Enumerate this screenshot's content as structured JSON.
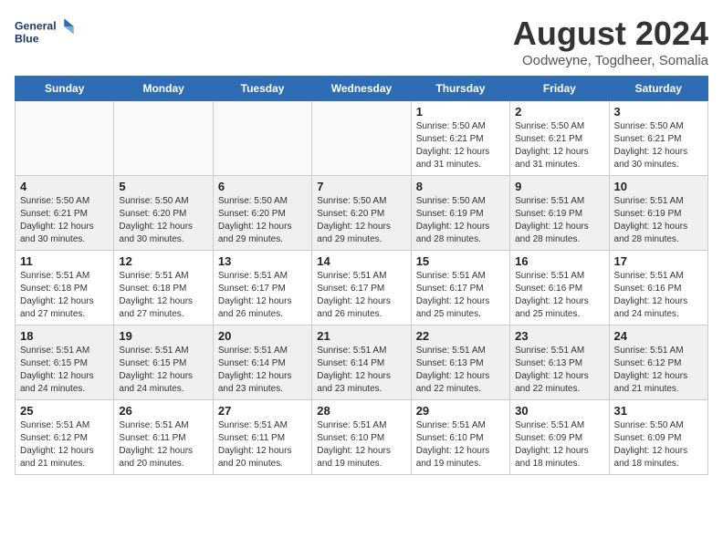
{
  "logo": {
    "line1": "General",
    "line2": "Blue"
  },
  "title": "August 2024",
  "location": "Oodweyne, Togdheer, Somalia",
  "days_of_week": [
    "Sunday",
    "Monday",
    "Tuesday",
    "Wednesday",
    "Thursday",
    "Friday",
    "Saturday"
  ],
  "weeks": [
    [
      {
        "day": "",
        "info": ""
      },
      {
        "day": "",
        "info": ""
      },
      {
        "day": "",
        "info": ""
      },
      {
        "day": "",
        "info": ""
      },
      {
        "day": "1",
        "info": "Sunrise: 5:50 AM\nSunset: 6:21 PM\nDaylight: 12 hours\nand 31 minutes."
      },
      {
        "day": "2",
        "info": "Sunrise: 5:50 AM\nSunset: 6:21 PM\nDaylight: 12 hours\nand 31 minutes."
      },
      {
        "day": "3",
        "info": "Sunrise: 5:50 AM\nSunset: 6:21 PM\nDaylight: 12 hours\nand 30 minutes."
      }
    ],
    [
      {
        "day": "4",
        "info": "Sunrise: 5:50 AM\nSunset: 6:21 PM\nDaylight: 12 hours\nand 30 minutes."
      },
      {
        "day": "5",
        "info": "Sunrise: 5:50 AM\nSunset: 6:20 PM\nDaylight: 12 hours\nand 30 minutes."
      },
      {
        "day": "6",
        "info": "Sunrise: 5:50 AM\nSunset: 6:20 PM\nDaylight: 12 hours\nand 29 minutes."
      },
      {
        "day": "7",
        "info": "Sunrise: 5:50 AM\nSunset: 6:20 PM\nDaylight: 12 hours\nand 29 minutes."
      },
      {
        "day": "8",
        "info": "Sunrise: 5:50 AM\nSunset: 6:19 PM\nDaylight: 12 hours\nand 28 minutes."
      },
      {
        "day": "9",
        "info": "Sunrise: 5:51 AM\nSunset: 6:19 PM\nDaylight: 12 hours\nand 28 minutes."
      },
      {
        "day": "10",
        "info": "Sunrise: 5:51 AM\nSunset: 6:19 PM\nDaylight: 12 hours\nand 28 minutes."
      }
    ],
    [
      {
        "day": "11",
        "info": "Sunrise: 5:51 AM\nSunset: 6:18 PM\nDaylight: 12 hours\nand 27 minutes."
      },
      {
        "day": "12",
        "info": "Sunrise: 5:51 AM\nSunset: 6:18 PM\nDaylight: 12 hours\nand 27 minutes."
      },
      {
        "day": "13",
        "info": "Sunrise: 5:51 AM\nSunset: 6:17 PM\nDaylight: 12 hours\nand 26 minutes."
      },
      {
        "day": "14",
        "info": "Sunrise: 5:51 AM\nSunset: 6:17 PM\nDaylight: 12 hours\nand 26 minutes."
      },
      {
        "day": "15",
        "info": "Sunrise: 5:51 AM\nSunset: 6:17 PM\nDaylight: 12 hours\nand 25 minutes."
      },
      {
        "day": "16",
        "info": "Sunrise: 5:51 AM\nSunset: 6:16 PM\nDaylight: 12 hours\nand 25 minutes."
      },
      {
        "day": "17",
        "info": "Sunrise: 5:51 AM\nSunset: 6:16 PM\nDaylight: 12 hours\nand 24 minutes."
      }
    ],
    [
      {
        "day": "18",
        "info": "Sunrise: 5:51 AM\nSunset: 6:15 PM\nDaylight: 12 hours\nand 24 minutes."
      },
      {
        "day": "19",
        "info": "Sunrise: 5:51 AM\nSunset: 6:15 PM\nDaylight: 12 hours\nand 24 minutes."
      },
      {
        "day": "20",
        "info": "Sunrise: 5:51 AM\nSunset: 6:14 PM\nDaylight: 12 hours\nand 23 minutes."
      },
      {
        "day": "21",
        "info": "Sunrise: 5:51 AM\nSunset: 6:14 PM\nDaylight: 12 hours\nand 23 minutes."
      },
      {
        "day": "22",
        "info": "Sunrise: 5:51 AM\nSunset: 6:13 PM\nDaylight: 12 hours\nand 22 minutes."
      },
      {
        "day": "23",
        "info": "Sunrise: 5:51 AM\nSunset: 6:13 PM\nDaylight: 12 hours\nand 22 minutes."
      },
      {
        "day": "24",
        "info": "Sunrise: 5:51 AM\nSunset: 6:12 PM\nDaylight: 12 hours\nand 21 minutes."
      }
    ],
    [
      {
        "day": "25",
        "info": "Sunrise: 5:51 AM\nSunset: 6:12 PM\nDaylight: 12 hours\nand 21 minutes."
      },
      {
        "day": "26",
        "info": "Sunrise: 5:51 AM\nSunset: 6:11 PM\nDaylight: 12 hours\nand 20 minutes."
      },
      {
        "day": "27",
        "info": "Sunrise: 5:51 AM\nSunset: 6:11 PM\nDaylight: 12 hours\nand 20 minutes."
      },
      {
        "day": "28",
        "info": "Sunrise: 5:51 AM\nSunset: 6:10 PM\nDaylight: 12 hours\nand 19 minutes."
      },
      {
        "day": "29",
        "info": "Sunrise: 5:51 AM\nSunset: 6:10 PM\nDaylight: 12 hours\nand 19 minutes."
      },
      {
        "day": "30",
        "info": "Sunrise: 5:51 AM\nSunset: 6:09 PM\nDaylight: 12 hours\nand 18 minutes."
      },
      {
        "day": "31",
        "info": "Sunrise: 5:50 AM\nSunset: 6:09 PM\nDaylight: 12 hours\nand 18 minutes."
      }
    ]
  ]
}
